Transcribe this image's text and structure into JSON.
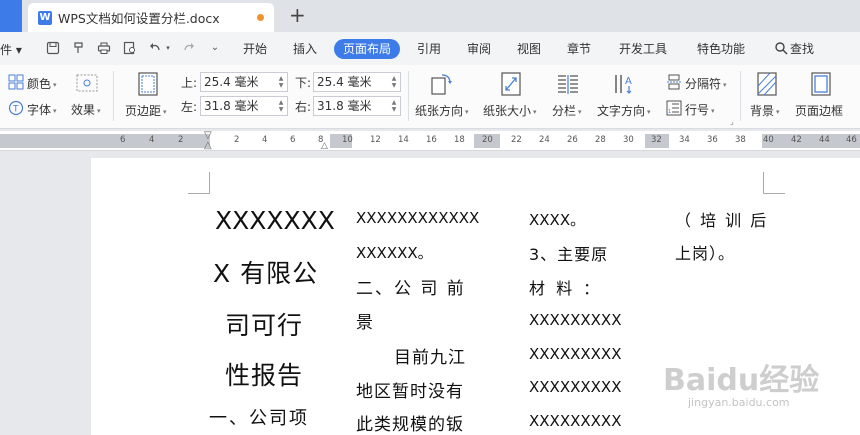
{
  "tab": {
    "badge": "W",
    "title": "WPS文档如何设置分栏.docx",
    "new_tab": "+"
  },
  "menu": {
    "file": "件 ▾",
    "tabs": [
      "开始",
      "插入",
      "页面布局",
      "引用",
      "审阅",
      "视图",
      "章节",
      "开发工具",
      "特色功能",
      "查找"
    ],
    "active": "页面布局"
  },
  "ribbon": {
    "color": "颜色",
    "font": "字体",
    "effect": "效果",
    "margins": "页边距",
    "top_label": "上:",
    "top_value": "25.4 毫米",
    "bottom_label": "下:",
    "bottom_value": "25.4 毫米",
    "left_label": "左:",
    "left_value": "31.8 毫米",
    "right_label": "右:",
    "right_value": "31.8 毫米",
    "orientation": "纸张方向",
    "size": "纸张大小",
    "columns": "分栏",
    "text_direction": "文字方向",
    "breaks": "分隔符",
    "line_numbers": "行号",
    "background": "背景",
    "page_border": "页面边框"
  },
  "ruler": {
    "numbers": [
      "6",
      "4",
      "2",
      "2",
      "4",
      "6",
      "8",
      "10",
      "12",
      "14",
      "16",
      "18",
      "20",
      "22",
      "24",
      "26",
      "28",
      "30",
      "32",
      "34",
      "36",
      "38",
      "40",
      "42",
      "44",
      "46"
    ]
  },
  "doc": {
    "col1": [
      "XXXXXXX",
      "X 有限公",
      "司可行",
      "性报告",
      "一、公司项"
    ],
    "col2": [
      "XXXXXXXXXXXX",
      "XXXXXX。",
      "二、公 司 前",
      "景",
      "目前九江",
      "地区暂时没有",
      "此类规模的钣"
    ],
    "col3": [
      "XXXX。",
      "3、主要原",
      "材  料 ：",
      "XXXXXXXXX",
      "XXXXXXXXX",
      "XXXXXXXXX",
      "XXXXXXXXX"
    ],
    "col4": [
      "（ 培 训 后",
      "上岗）。"
    ]
  },
  "watermark": {
    "main": "Baidu经验",
    "sub": "jingyan.baidu.com"
  }
}
